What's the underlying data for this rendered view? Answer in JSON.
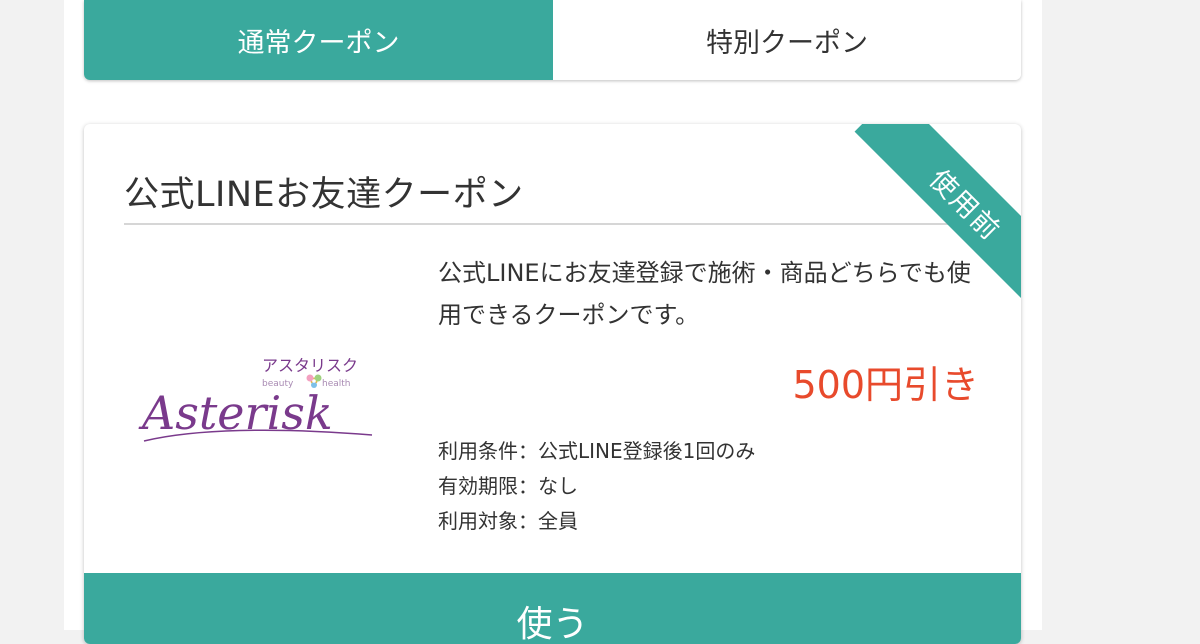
{
  "tabs": {
    "normal_label": "通常クーポン",
    "special_label": "特別クーポン"
  },
  "coupon": {
    "title": "公式LINEお友達クーポン",
    "status_ribbon": "使用前",
    "logo": {
      "katakana": "アスタリスク",
      "tagline_left": "beauty",
      "tagline_right": "health",
      "name": "Asterisk"
    },
    "description": "公式LINEにお友達登録で施術・商品どちらでも使用できるクーポンです。",
    "discount": "500円引き",
    "conditions": [
      {
        "label": "利用条件",
        "sep": "：",
        "value": "公式LINE登録後1回のみ"
      },
      {
        "label": "有効期限",
        "sep": "：",
        "value": "なし"
      },
      {
        "label": "利用対象",
        "sep": "：",
        "value": "全員"
      }
    ],
    "use_button": "使う"
  },
  "colors": {
    "accent": "#3aa99d",
    "price": "#e84a2c",
    "logo_purple": "#7a3a8c"
  }
}
